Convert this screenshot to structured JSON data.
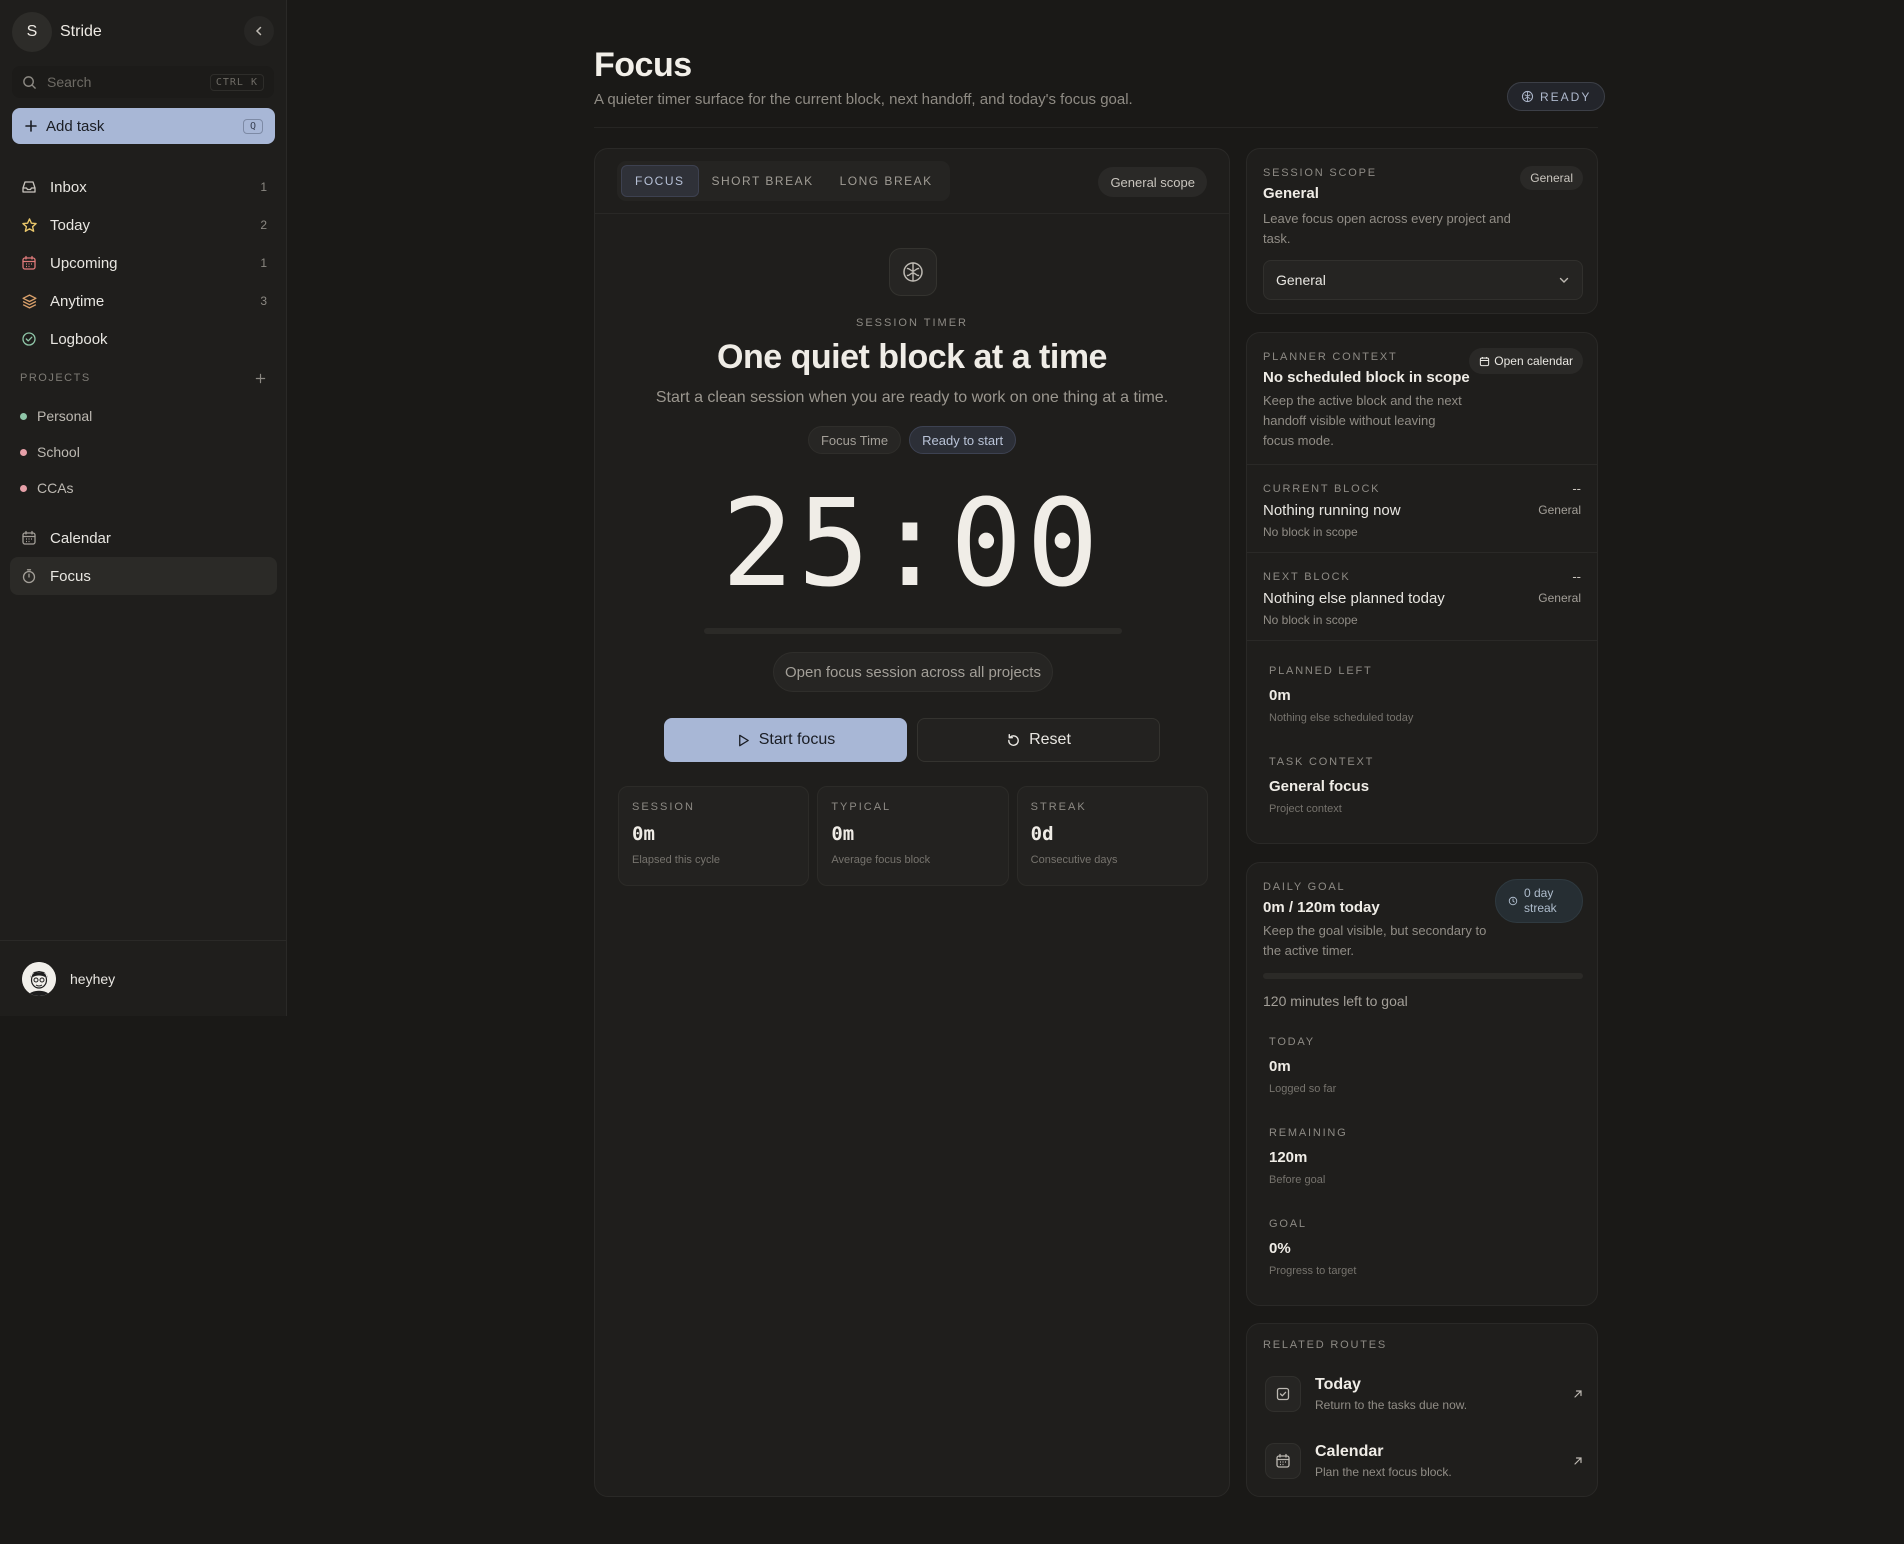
{
  "app": {
    "workspace_initial": "S",
    "workspace_name": "Stride",
    "search_placeholder": "Search",
    "search_shortcut": "CTRL K",
    "add_task_label": "Add task",
    "add_task_shortcut": "Q"
  },
  "sidebar": {
    "nav": [
      {
        "label": "Inbox",
        "count": "1",
        "icon": "inbox-icon"
      },
      {
        "label": "Today",
        "count": "2",
        "icon": "star-icon"
      },
      {
        "label": "Upcoming",
        "count": "1",
        "icon": "calendar-icon"
      },
      {
        "label": "Anytime",
        "count": "3",
        "icon": "layers-icon"
      },
      {
        "label": "Logbook",
        "count": "",
        "icon": "check-circle-icon"
      }
    ],
    "projects_heading": "PROJECTS",
    "projects": [
      {
        "label": "Personal",
        "color": "#8fc6a8"
      },
      {
        "label": "School",
        "color": "#e6a0a8"
      },
      {
        "label": "CCAs",
        "color": "#e6a0a8"
      }
    ],
    "nav2": [
      {
        "label": "Calendar",
        "icon": "calendar-grid-icon"
      },
      {
        "label": "Focus",
        "icon": "timer-icon"
      }
    ],
    "user_name": "heyhey"
  },
  "header": {
    "title": "Focus",
    "subtitle": "A quieter timer surface for the current block, next handoff, and today's focus goal.",
    "status": "READY"
  },
  "timer": {
    "tabs": [
      "FOCUS",
      "SHORT BREAK",
      "LONG BREAK"
    ],
    "active_tab": "FOCUS",
    "scope_pill": "General scope",
    "label": "SESSION TIMER",
    "headline": "One quiet block at a time",
    "subline": "Start a clean session when you are ready to work on one thing at a time.",
    "chip_type": "Focus Time",
    "chip_state": "Ready to start",
    "clock": "25:00",
    "progress": 0,
    "scope_note": "Open focus session across all projects",
    "start_label": "Start focus",
    "reset_label": "Reset",
    "stats": [
      {
        "key": "SESSION",
        "value": "0m",
        "desc": "Elapsed this cycle"
      },
      {
        "key": "TYPICAL",
        "value": "0m",
        "desc": "Average focus block"
      },
      {
        "key": "STREAK",
        "value": "0d",
        "desc": "Consecutive days"
      }
    ]
  },
  "scope": {
    "eyebrow": "SESSION SCOPE",
    "title": "General",
    "desc": "Leave focus open across every project and task.",
    "pill": "General",
    "select_value": "General"
  },
  "planner": {
    "eyebrow": "PLANNER CONTEXT",
    "title": "No scheduled block in scope",
    "desc": "Keep the active block and the next handoff visible without leaving focus mode.",
    "open_calendar": "Open calendar",
    "current": {
      "eyebrow": "CURRENT BLOCK",
      "title": "Nothing running now",
      "sub": "No block in scope",
      "time": "--",
      "tag": "General"
    },
    "next": {
      "eyebrow": "NEXT BLOCK",
      "title": "Nothing else planned today",
      "sub": "No block in scope",
      "time": "--",
      "tag": "General"
    },
    "planned_left": {
      "key": "PLANNED LEFT",
      "value": "0m",
      "desc": "Nothing else scheduled today"
    },
    "task_context": {
      "key": "TASK CONTEXT",
      "value": "General focus",
      "desc": "Project context"
    }
  },
  "goal": {
    "eyebrow": "DAILY GOAL",
    "title": "0m / 120m today",
    "desc": "Keep the goal visible, but secondary to the active timer.",
    "streak": "0 day streak",
    "progress": 0,
    "left_text": "120 minutes left to goal",
    "metrics": [
      {
        "key": "TODAY",
        "value": "0m",
        "desc": "Logged so far"
      },
      {
        "key": "REMAINING",
        "value": "120m",
        "desc": "Before goal"
      },
      {
        "key": "GOAL",
        "value": "0%",
        "desc": "Progress to target"
      }
    ]
  },
  "routes": {
    "eyebrow": "RELATED ROUTES",
    "items": [
      {
        "title": "Today",
        "desc": "Return to the tasks due now.",
        "icon": "check-square-icon"
      },
      {
        "title": "Calendar",
        "desc": "Plan the next focus block.",
        "icon": "calendar-grid-icon"
      }
    ]
  },
  "colors": {
    "accent": "#a8b7d6",
    "background": "#1a1917",
    "panel": "#1f1e1c"
  }
}
